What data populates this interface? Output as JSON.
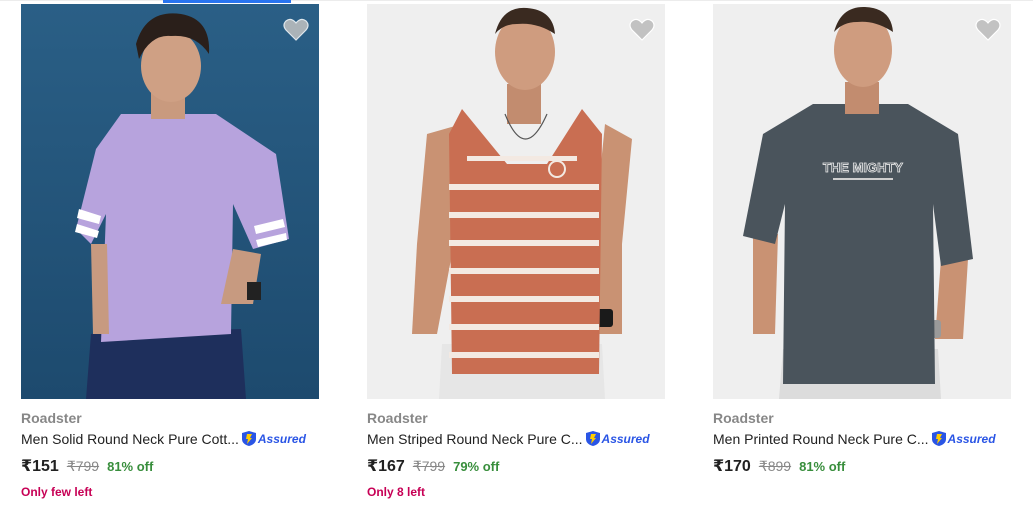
{
  "products": [
    {
      "brand": "Roadster",
      "title": "Men Solid Round Neck Pure Cott...",
      "assured_label": "Assured",
      "price": "₹151",
      "mrp": "₹799",
      "discount": "81% off",
      "stock_note": "Only few left"
    },
    {
      "brand": "Roadster",
      "title": "Men Striped Round Neck Pure C...",
      "assured_label": "Assured",
      "price": "₹167",
      "mrp": "₹799",
      "discount": "79% off",
      "stock_note": "Only 8 left"
    },
    {
      "brand": "Roadster",
      "title": "Men Printed Round Neck Pure C...",
      "assured_label": "Assured",
      "price": "₹170",
      "mrp": "₹899",
      "discount": "81% off",
      "stock_note": ""
    }
  ],
  "colors": {
    "accent": "#2874f0",
    "discount": "#388e3c",
    "stock": "#c70055",
    "assured": "#2a55e5"
  },
  "icons": [
    "wishlist-heart-icon",
    "assured-badge-icon"
  ]
}
